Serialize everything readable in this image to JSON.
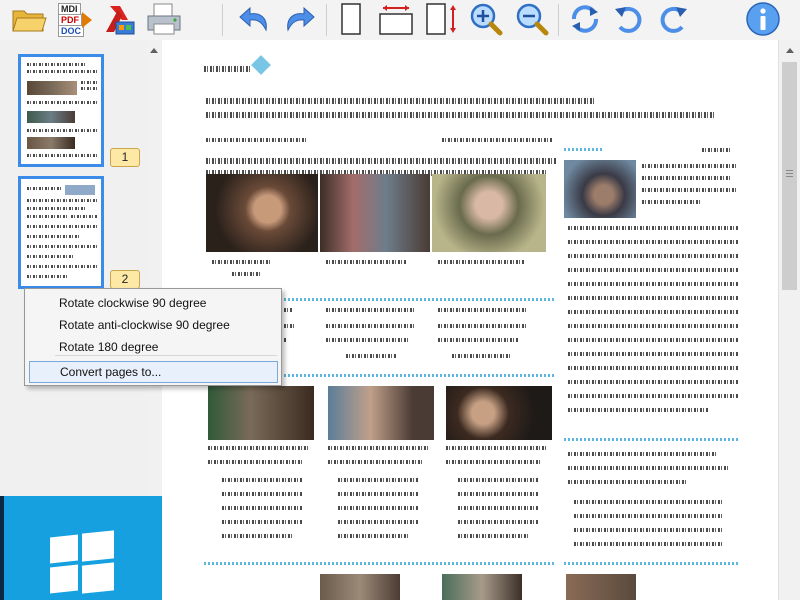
{
  "toolbar": {
    "buttons": [
      {
        "name": "open-folder-icon"
      },
      {
        "name": "convert-mdi-pdf-doc-icon",
        "labels": [
          "MDI",
          "PDF",
          "DOC"
        ]
      },
      {
        "name": "export-icon"
      },
      {
        "name": "print-icon"
      },
      {
        "name": "undo-icon"
      },
      {
        "name": "redo-icon"
      },
      {
        "name": "fit-page-icon"
      },
      {
        "name": "fit-width-icon"
      },
      {
        "name": "fit-height-icon"
      },
      {
        "name": "zoom-in-icon"
      },
      {
        "name": "zoom-out-icon"
      },
      {
        "name": "rotate-icon"
      },
      {
        "name": "rotate-anticlockwise-icon"
      },
      {
        "name": "rotate-clockwise-icon"
      },
      {
        "name": "info-icon"
      }
    ]
  },
  "sidebar": {
    "pages": [
      {
        "number": "1"
      },
      {
        "number": "2"
      }
    ]
  },
  "context_menu": {
    "items": [
      {
        "label": "Rotate clockwise 90 degree"
      },
      {
        "label": "Rotate anti-clockwise 90 degree"
      },
      {
        "label": "Rotate 180 degree"
      },
      {
        "label": "Convert pages to..."
      }
    ]
  },
  "colors": {
    "accent": "#3b8be8",
    "badge": "#fde8a6",
    "menu_highlight": "#e8f1fb",
    "windows_blue": "#17a0df"
  }
}
